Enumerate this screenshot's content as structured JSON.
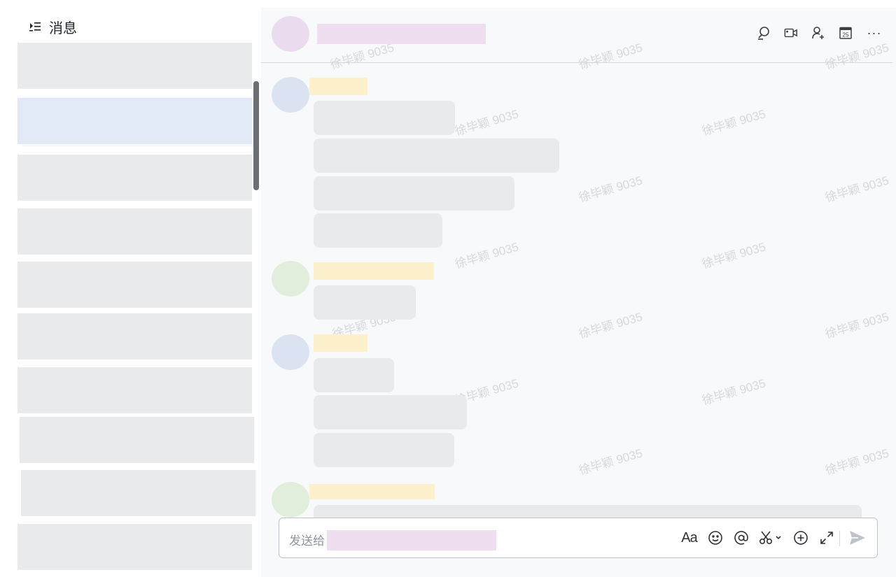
{
  "sidebar": {
    "title": "消息",
    "menu_icon": "collapse-menu-icon",
    "conversations": [
      "",
      "",
      "",
      "",
      "",
      "",
      "",
      "",
      "",
      ""
    ]
  },
  "chat": {
    "header": {
      "tools": [
        "search-icon",
        "video-call-icon",
        "add-member-icon",
        "calendar-icon",
        "more-icon"
      ],
      "calendar_day": "25",
      "more_glyph": "···"
    },
    "watermark": "徐毕颖 9035"
  },
  "composer": {
    "placeholder": "发送给",
    "text_format_glyph": "Aa",
    "tools": [
      "text-format-icon",
      "emoji-icon",
      "mention-icon",
      "screenshot-icon",
      "add-icon",
      "expand-icon"
    ],
    "send_icon": "send-icon"
  },
  "colors": {
    "redaction_purple": "#efdef0",
    "redaction_yellow": "#fdf0cc",
    "bubble_gray": "#e9eaeb",
    "chat_bg": "#f8f9fb",
    "send_gray": "#bfc3c9"
  }
}
